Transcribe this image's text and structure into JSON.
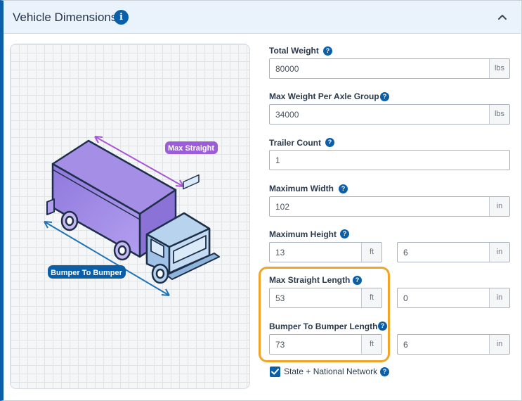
{
  "panel": {
    "title": "Vehicle Dimensions",
    "info_icon": "info-icon",
    "info_glyph": "i",
    "collapse_icon": "chevron-up-icon"
  },
  "illustration": {
    "max_straight_label": "Max Straight",
    "bumper_label": "Bumper To Bumper"
  },
  "fields": {
    "total_weight": {
      "label": "Total Weight",
      "value": "80000",
      "unit": "lbs"
    },
    "max_weight_axle": {
      "label": "Max Weight Per Axle Group",
      "value": "34000",
      "unit": "lbs"
    },
    "trailer_count": {
      "label": "Trailer Count",
      "value": "1"
    },
    "max_width": {
      "label": "Maximum Width",
      "value": "102",
      "unit": "in"
    },
    "max_height": {
      "label": "Maximum Height",
      "ft_value": "13",
      "ft_unit": "ft",
      "in_value": "6",
      "in_unit": "in"
    },
    "max_straight_length": {
      "label": "Max Straight Length",
      "ft_value": "53",
      "ft_unit": "ft",
      "in_value": "0",
      "in_unit": "in"
    },
    "bumper_length": {
      "label": "Bumper To Bumper Length",
      "ft_value": "73",
      "ft_unit": "ft",
      "in_value": "6",
      "in_unit": "in"
    }
  },
  "help_glyph": "?",
  "network_checkbox": {
    "label": "State + National Network",
    "checked": true
  },
  "colors": {
    "accent": "#0a5fa8",
    "highlight": "#f0a526",
    "truck_box": "#9b7fe0",
    "truck_cab": "#a9c8e8",
    "max_straight_arrow": "#a855d8",
    "bumper_arrow": "#1f73b7"
  }
}
